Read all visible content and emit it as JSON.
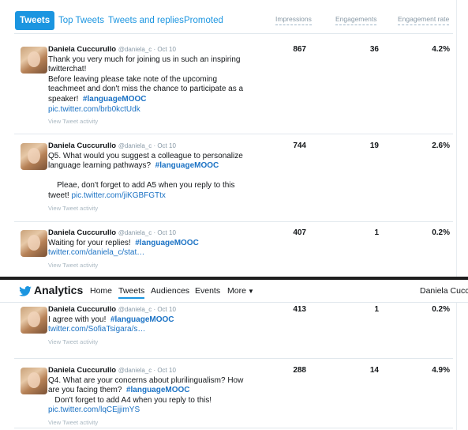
{
  "tabs": [
    "Tweets",
    "Top Tweets",
    "Tweets and replies",
    "Promoted"
  ],
  "columns": {
    "impressions": "Impressions",
    "engagements": "Engagements",
    "rate": "Engagement rate"
  },
  "activity_label": "View Tweet activity",
  "tweets_top": [
    {
      "name": "Daniela Cuccurullo",
      "meta": "@daniela_c · Oct 10",
      "lines": [
        {
          "t": "Thank you very much for joining us in such an inspiring"
        },
        {
          "t": "twitterchat!"
        },
        {
          "t": "Before leaving please take note of the upcoming"
        },
        {
          "t": "teachmeet and don't miss the chance to participate as a"
        },
        {
          "t": "speaker!",
          "tag": "#languageMOOC"
        },
        {
          "link": "pic.twitter.com/brb0kctUdk"
        }
      ],
      "impressions": "867",
      "engagements": "36",
      "rate": "4.2%"
    },
    {
      "name": "Daniela Cuccurullo",
      "meta": "@daniela_c · Oct 10",
      "lines": [
        {
          "t": "Q5. What would you suggest a colleague to personalize"
        },
        {
          "t": "language learning pathways?",
          "tag": "#languageMOOC"
        },
        {
          "t": " "
        },
        {
          "t": "    Pleae, don't forget to add A5 when you reply to this"
        },
        {
          "t": "tweet!",
          "link": "pic.twitter.com/jiKGBFGTtx"
        }
      ],
      "impressions": "744",
      "engagements": "19",
      "rate": "2.6%"
    },
    {
      "name": "Daniela Cuccurullo",
      "meta": "@daniela_c · Oct 10",
      "lines": [
        {
          "t": "Waiting for your replies!",
          "tag": "#languageMOOC"
        },
        {
          "link": "twitter.com/daniela_c/stat…"
        }
      ],
      "impressions": "407",
      "engagements": "1",
      "rate": "0.2%"
    }
  ],
  "nav": {
    "brand": "Analytics",
    "items": [
      "Home",
      "Tweets",
      "Audiences",
      "Events",
      "More"
    ],
    "user": "Daniela Cuccu"
  },
  "tweets_bottom": [
    {
      "name": "Daniela Cuccurullo",
      "meta": "@daniela_c · Oct 10",
      "lines": [
        {
          "t": "I agree with you!",
          "tag": "#languageMOOC"
        },
        {
          "link": "twitter.com/SofiaTsigara/s…"
        }
      ],
      "impressions": "413",
      "engagements": "1",
      "rate": "0.2%"
    },
    {
      "name": "Daniela Cuccurullo",
      "meta": "@daniela_c · Oct 10",
      "lines": [
        {
          "t": "Q4. What are your concerns about plurilingualism? How"
        },
        {
          "t": "are you facing them?",
          "tag": "#languageMOOC"
        },
        {
          "t": "   Don't forget to add A4 when you reply to this!"
        },
        {
          "link": "pic.twitter.com/lqCEjjimYS"
        }
      ],
      "impressions": "288",
      "engagements": "14",
      "rate": "4.9%"
    }
  ],
  "colors": {
    "accent": "#1b95e0",
    "link": "#1b72c4",
    "muted": "#8899a6"
  }
}
